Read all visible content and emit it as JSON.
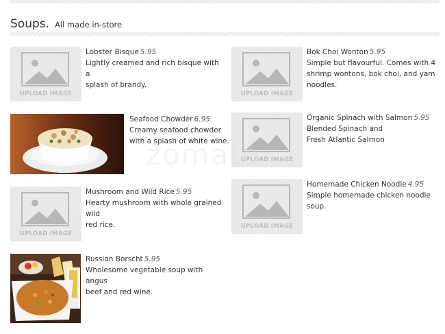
{
  "section": {
    "title": "Soups.",
    "subtitle": "All made in-store"
  },
  "placeholder_label": "UPLOAD IMAGE",
  "watermark": "zomato",
  "items": [
    {
      "name": "Lobster Bisque",
      "price": "5.95",
      "desc": [
        "Lightly creamed and rich bisque with a",
        "splash of brandy."
      ]
    },
    {
      "name": "Seafood Chowder",
      "price": "6.95",
      "desc": [
        "Creamy seafood chowder",
        "with a splash of white wine."
      ]
    },
    {
      "name": "Mushroom and Wild Rice",
      "price": "5.95",
      "desc": [
        "Hearty mushroom with whole grained wild",
        "red rice."
      ]
    },
    {
      "name": "Russian Borscht",
      "price": "5.95",
      "desc": [
        "Wholesome vegetable soup with angus",
        "beef and red wine."
      ]
    },
    {
      "name": "Bok Choi Wonton",
      "price": "5.95",
      "desc": [
        "Simple but flavourful. Comes with 4",
        "shrimp wontons, bok choi, and yam",
        "noodles."
      ]
    },
    {
      "name": "Organic Spinach with Salmon",
      "price": "5.95",
      "desc": [
        "Blended Spinach and",
        "Fresh Atlantic Salmon"
      ]
    },
    {
      "name": "Homemade Chicken Noodle",
      "price": "4.95",
      "desc": [
        "Simple homemade chicken noodle soup."
      ]
    }
  ]
}
